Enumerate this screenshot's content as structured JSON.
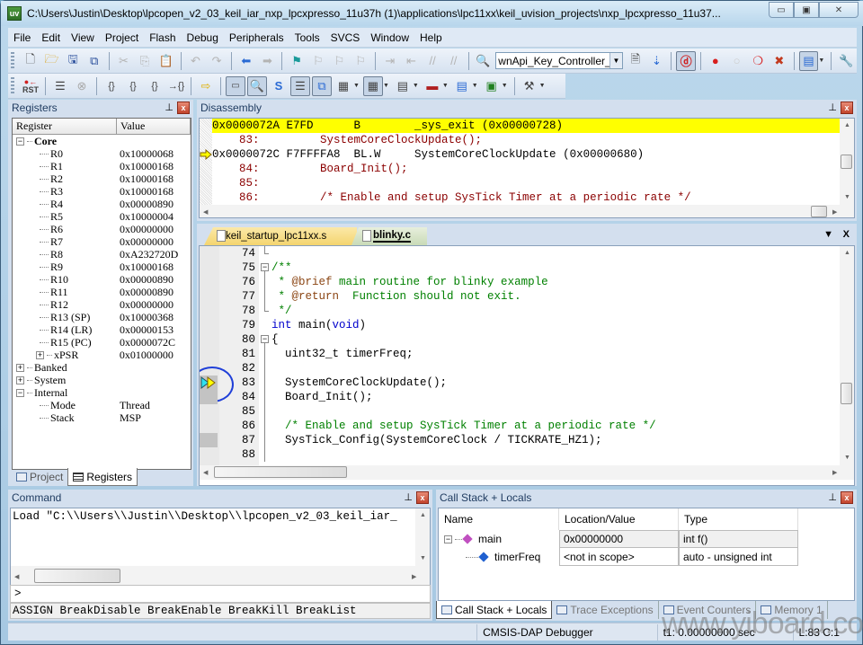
{
  "window": {
    "title": "C:\\Users\\Justin\\Desktop\\lpcopen_v2_03_keil_iar_nxp_lpcxpresso_11u37h (1)\\applications\\lpc11xx\\keil_uvision_projects\\nxp_lpcxpresso_11u37...",
    "app_icon": "uv",
    "controls": {
      "minimize": "▭",
      "maximize": "▣",
      "close": "✕"
    }
  },
  "menu": [
    "File",
    "Edit",
    "View",
    "Project",
    "Flash",
    "Debug",
    "Peripherals",
    "Tools",
    "SVCS",
    "Window",
    "Help"
  ],
  "toolbar": {
    "target_select": "wnApi_Key_Controller_Sc",
    "icons_row1": [
      "new-file-icon",
      "open-folder-icon",
      "save-icon",
      "save-all-icon",
      "cut-icon",
      "copy-icon",
      "paste-icon",
      "undo-icon",
      "redo-icon",
      "nav-back-icon",
      "nav-forward-icon",
      "bookmark-icon",
      "bookmark-prev-icon",
      "bookmark-next-icon",
      "bookmark-clear-icon",
      "indent-icon",
      "unindent-icon",
      "comment-icon",
      "uncomment-icon",
      "find-in-files-icon",
      "find-icon",
      "incremental-find-icon",
      "debug-session-icon",
      "breakpoint-insert-icon",
      "breakpoint-disable-icon",
      "breakpoint-disable-all-icon",
      "breakpoint-kill-all-icon",
      "window-layout-icon",
      "configure-icon"
    ],
    "icons_row2": [
      "reset-icon",
      "run-icon",
      "stop-icon",
      "step-into-icon",
      "step-over-icon",
      "step-out-icon",
      "run-to-cursor-icon",
      "show-next-statement-icon",
      "command-window-icon",
      "disassembly-window-icon",
      "symbols-window-icon",
      "registers-window-icon",
      "call-stack-window-icon",
      "watch-windows-icon",
      "memory-windows-icon",
      "serial-windows-icon",
      "analysis-windows-icon",
      "trace-windows-icon",
      "system-viewer-icon",
      "toolbox-icon"
    ],
    "reset_label": "RST"
  },
  "registers": {
    "title": "Registers",
    "columns": [
      "Register",
      "Value"
    ],
    "core_label": "Core",
    "core": [
      {
        "name": "R0",
        "value": "0x10000068"
      },
      {
        "name": "R1",
        "value": "0x10000168"
      },
      {
        "name": "R2",
        "value": "0x10000168"
      },
      {
        "name": "R3",
        "value": "0x10000168"
      },
      {
        "name": "R4",
        "value": "0x00000890"
      },
      {
        "name": "R5",
        "value": "0x10000004"
      },
      {
        "name": "R6",
        "value": "0x00000000"
      },
      {
        "name": "R7",
        "value": "0x00000000"
      },
      {
        "name": "R8",
        "value": "0xA232720D"
      },
      {
        "name": "R9",
        "value": "0x10000168"
      },
      {
        "name": "R10",
        "value": "0x00000890"
      },
      {
        "name": "R11",
        "value": "0x00000890"
      },
      {
        "name": "R12",
        "value": "0x00000000"
      },
      {
        "name": "R13 (SP)",
        "value": "0x10000368"
      },
      {
        "name": "R14 (LR)",
        "value": "0x00000153"
      },
      {
        "name": "R15 (PC)",
        "value": "0x0000072C"
      },
      {
        "name": "xPSR",
        "value": "0x01000000"
      }
    ],
    "groups": [
      "Banked",
      "System",
      "Internal"
    ],
    "internal": [
      {
        "name": "Mode",
        "value": "Thread"
      },
      {
        "name": "Stack",
        "value": "MSP"
      }
    ],
    "tabs": [
      "Project",
      "Registers"
    ]
  },
  "disassembly": {
    "title": "Disassembly",
    "lines": [
      {
        "text": "0x0000072A E7FD      B        _sys_exit (0x00000728)",
        "kind": "highlight"
      },
      {
        "text": "    83:         SystemCoreClockUpdate();",
        "kind": "source"
      },
      {
        "text": "0x0000072C F7FFFFA8  BL.W     SystemCoreClockUpdate (0x00000680)",
        "kind": "current"
      },
      {
        "text": "    84:         Board_Init();",
        "kind": "source"
      },
      {
        "text": "    85: ",
        "kind": "source"
      },
      {
        "text": "    86:         /* Enable and setup SysTick Timer at a periodic rate */",
        "kind": "source"
      }
    ]
  },
  "editor": {
    "tabs": [
      "keil_startup_lpc11xx.s",
      "blinky.c"
    ],
    "active_tab": "blinky.c",
    "lines": [
      {
        "n": "74",
        "fold": "end",
        "text": "",
        "cls": ""
      },
      {
        "n": "75",
        "fold": "open",
        "text": "/**",
        "cls": "c-comment"
      },
      {
        "n": "76",
        "fold": "line",
        "text": " * @brief main routine for blinky example",
        "cls": "c-comment"
      },
      {
        "n": "77",
        "fold": "line",
        "text": " * @return  Function should not exit.",
        "cls": "c-comment"
      },
      {
        "n": "78",
        "fold": "end",
        "text": " */",
        "cls": "c-comment"
      },
      {
        "n": "79",
        "fold": "",
        "text": "int main(void)",
        "cls": "c-kw-line"
      },
      {
        "n": "80",
        "fold": "open",
        "text": "{",
        "cls": ""
      },
      {
        "n": "81",
        "fold": "line",
        "text": "  uint32_t timerFreq;",
        "cls": ""
      },
      {
        "n": "82",
        "fold": "line",
        "text": "",
        "cls": ""
      },
      {
        "n": "83",
        "fold": "line",
        "text": "  SystemCoreClockUpdate();",
        "cls": ""
      },
      {
        "n": "84",
        "fold": "line",
        "text": "  Board_Init();",
        "cls": ""
      },
      {
        "n": "85",
        "fold": "line",
        "text": "",
        "cls": ""
      },
      {
        "n": "86",
        "fold": "line",
        "text": "  /* Enable and setup SysTick Timer at a periodic rate */",
        "cls": "c-comment"
      },
      {
        "n": "87",
        "fold": "line",
        "text": "  SysTick_Config(SystemCoreClock / TICKRATE_HZ1);",
        "cls": ""
      },
      {
        "n": "88",
        "fold": "line",
        "text": "",
        "cls": ""
      }
    ],
    "current_line": "83",
    "tab_menu": "▼",
    "tab_close": "X"
  },
  "command": {
    "title": "Command",
    "output": "Load \"C:\\\\Users\\\\Justin\\\\Desktop\\\\lpcopen_v2_03_keil_iar_",
    "prompt": ">",
    "hint": "ASSIGN BreakDisable BreakEnable BreakKill BreakList"
  },
  "callstack": {
    "title": "Call Stack + Locals",
    "columns": [
      "Name",
      "Location/Value",
      "Type"
    ],
    "rows": [
      {
        "name": "main",
        "value": "0x00000000",
        "type": "int f()",
        "color": "#c050c0"
      },
      {
        "name": "timerFreq",
        "value": "<not in scope>",
        "type": "auto - unsigned int",
        "color": "#2060d0"
      }
    ],
    "tabs": [
      "Call Stack + Locals",
      "Trace Exceptions",
      "Event Counters",
      "Memory 1"
    ]
  },
  "statusbar": {
    "debugger": "CMSIS-DAP Debugger",
    "time": "t1: 0.00000000 sec",
    "position": "L:83 C:1"
  },
  "watermark": "www.yiboard.com",
  "colors": {
    "highlight": "#ffff00",
    "comment": "#008000",
    "keyword": "#0000cd",
    "disasm_source": "#8b0000",
    "annotation_circle": "#1f3fd8"
  }
}
